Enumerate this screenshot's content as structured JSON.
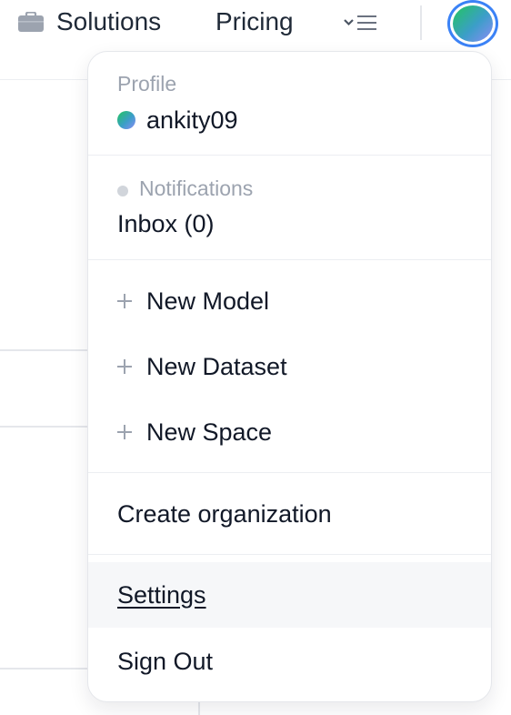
{
  "nav": {
    "items": [
      {
        "label": "Solutions",
        "icon": "briefcase-icon"
      },
      {
        "label": "Pricing"
      }
    ],
    "more_icon": "chevron-down-list-icon",
    "avatar_icon": "user-avatar"
  },
  "dropdown": {
    "profile": {
      "section_label": "Profile",
      "username": "ankity09"
    },
    "notifications": {
      "section_label": "Notifications",
      "inbox_label": "Inbox (0)"
    },
    "create_items": [
      {
        "label": "New Model",
        "icon": "plus-icon"
      },
      {
        "label": "New Dataset",
        "icon": "plus-icon"
      },
      {
        "label": "New Space",
        "icon": "plus-icon"
      }
    ],
    "create_org_label": "Create organization",
    "settings_label": "Settings",
    "sign_out_label": "Sign Out"
  },
  "colors": {
    "avatar_ring": "#3b82f6",
    "muted_text": "#9ca3af",
    "hover_row_bg": "#f6f7f9"
  }
}
